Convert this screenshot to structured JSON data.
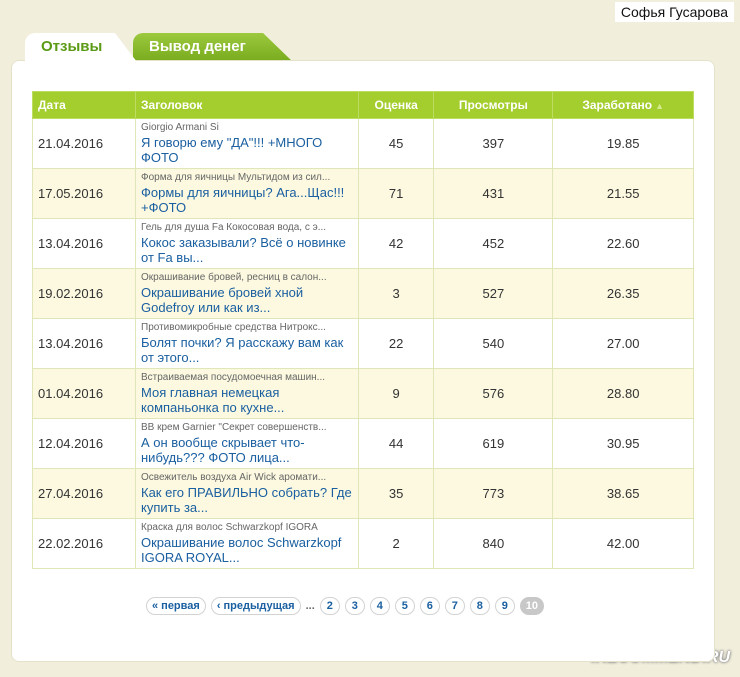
{
  "user": {
    "name": "Софья Гусарова"
  },
  "tabs": [
    {
      "label": "Отзывы"
    },
    {
      "label": "Вывод денег"
    }
  ],
  "table": {
    "headers": {
      "date": "Дата",
      "title": "Заголовок",
      "rating": "Оценка",
      "views": "Просмотры",
      "earned": "Заработано"
    },
    "rows": [
      {
        "date": "21.04.2016",
        "product": "Giorgio Armani Si",
        "title": "Я говорю ему \"ДА\"!!! +МНОГО ФОТО",
        "rating": "45",
        "views": "397",
        "earned": "19.85"
      },
      {
        "date": "17.05.2016",
        "product": "Форма для яичницы Мультидом из сил...",
        "title": "Формы для яичницы? Ага...Щас!!! +ФОТО",
        "rating": "71",
        "views": "431",
        "earned": "21.55"
      },
      {
        "date": "13.04.2016",
        "product": "Гель для душа Fa Кокосовая вода, с э...",
        "title": "Кокос заказывали? Всё о новинке от Fa вы...",
        "rating": "42",
        "views": "452",
        "earned": "22.60"
      },
      {
        "date": "19.02.2016",
        "product": "Окрашивание бровей, ресниц в салон...",
        "title": "Окрашивание бровей хной Godefroy или как из...",
        "rating": "3",
        "views": "527",
        "earned": "26.35"
      },
      {
        "date": "13.04.2016",
        "product": "Противомикробные средства Нитрокс...",
        "title": "Болят почки? Я расскажу вам как от этого...",
        "rating": "22",
        "views": "540",
        "earned": "27.00"
      },
      {
        "date": "01.04.2016",
        "product": "Встраиваемая посудомоечная машин...",
        "title": "Моя главная немецкая компаньонка по кухне...",
        "rating": "9",
        "views": "576",
        "earned": "28.80"
      },
      {
        "date": "12.04.2016",
        "product": "ВВ крем Garnier \"Секрет совершенств...",
        "title": "А он вообще скрывает что-нибудь??? ФОТО лица...",
        "rating": "44",
        "views": "619",
        "earned": "30.95"
      },
      {
        "date": "27.04.2016",
        "product": "Освежитель воздуха Air Wick аромати...",
        "title": "Как его ПРАВИЛЬНО собрать? Где купить за...",
        "rating": "35",
        "views": "773",
        "earned": "38.65"
      },
      {
        "date": "22.02.2016",
        "product": "Краска для волос Schwarzkopf IGORA",
        "title": "Окрашивание волос Schwarzkopf IGORA ROYAL...",
        "rating": "2",
        "views": "840",
        "earned": "42.00"
      }
    ]
  },
  "pager": {
    "first": "« первая",
    "prev": "‹ предыдущая",
    "dots": "...",
    "pages": [
      "2",
      "3",
      "4",
      "5",
      "6",
      "7",
      "8",
      "9"
    ],
    "current": "10"
  },
  "watermark": "iRECOMMEND.RU"
}
